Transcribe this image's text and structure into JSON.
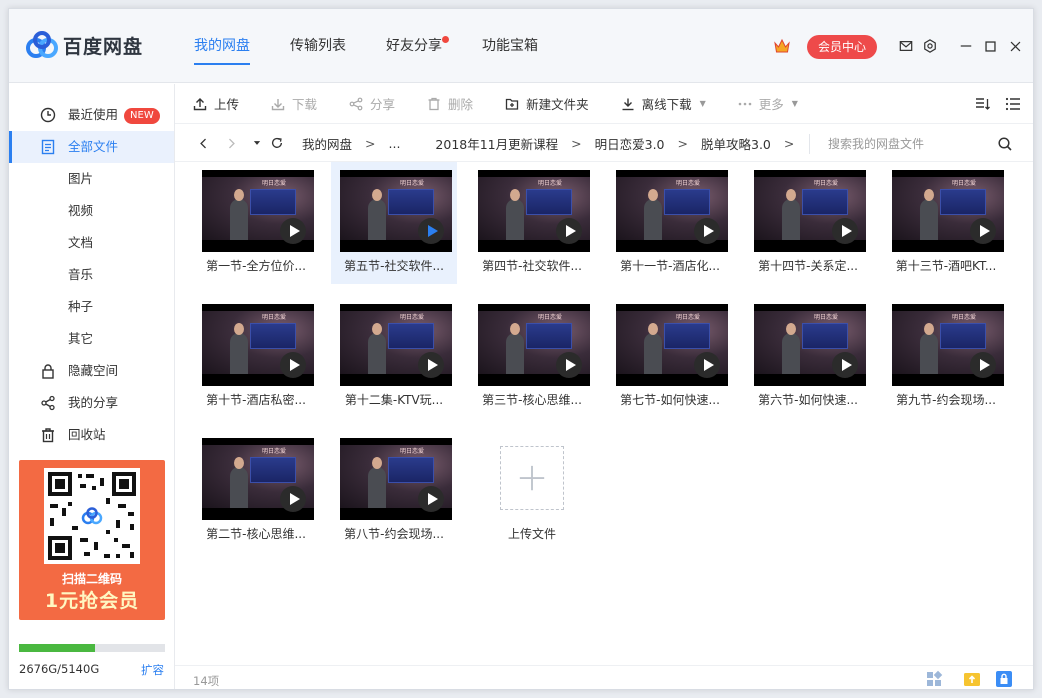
{
  "app": {
    "name": "百度网盘"
  },
  "nav": [
    {
      "label": "我的网盘",
      "active": true,
      "dot": false
    },
    {
      "label": "传输列表",
      "active": false,
      "dot": false
    },
    {
      "label": "好友分享",
      "active": false,
      "dot": true
    },
    {
      "label": "功能宝箱",
      "active": false,
      "dot": false
    }
  ],
  "header": {
    "vip_label": "会员中心"
  },
  "sidebar": {
    "recent": {
      "label": "最近使用",
      "badge": "NEW"
    },
    "all_files": {
      "label": "全部文件"
    },
    "categories": [
      "图片",
      "视频",
      "文档",
      "音乐",
      "种子",
      "其它"
    ],
    "hidden_space": {
      "label": "隐藏空间"
    },
    "my_share": {
      "label": "我的分享"
    },
    "recycle": {
      "label": "回收站"
    },
    "promo": {
      "line1": "扫描二维码",
      "line2": "1元抢会员"
    },
    "storage": {
      "text": "2676G/5140G",
      "used_fraction": 0.52,
      "expand": "扩容"
    }
  },
  "toolbar": {
    "upload": "上传",
    "download": "下载",
    "share": "分享",
    "delete": "删除",
    "new_folder": "新建文件夹",
    "offline": "离线下载",
    "more": "更多"
  },
  "address": {
    "crumbs": [
      "我的网盘",
      "...",
      "2018年11月更新课程",
      "明日恋爱3.0",
      "脱单攻略3.0"
    ],
    "separator": ">",
    "search_placeholder": "搜索我的网盘文件"
  },
  "thumb_brand": "明日恋爱",
  "files": [
    "第一节-全方位价...",
    "第五节-社交软件...",
    "第四节-社交软件...",
    "第十一节-酒店化...",
    "第十四节-关系定...",
    "第十三节-酒吧KT...",
    "第十节-酒店私密...",
    "第十二集-KTV玩...",
    "第三节-核心思维...",
    "第七节-如何快速...",
    "第六节-如何快速...",
    "第九节-约会现场...",
    "第二节-核心思维...",
    "第八节-约会现场..."
  ],
  "selected_index": 1,
  "upload_tile": {
    "label": "上传文件"
  },
  "status": {
    "count": "14项"
  },
  "colors": {
    "accent": "#2b7ff0",
    "vip": "#ee4a4a",
    "storage": "#4ab840"
  }
}
